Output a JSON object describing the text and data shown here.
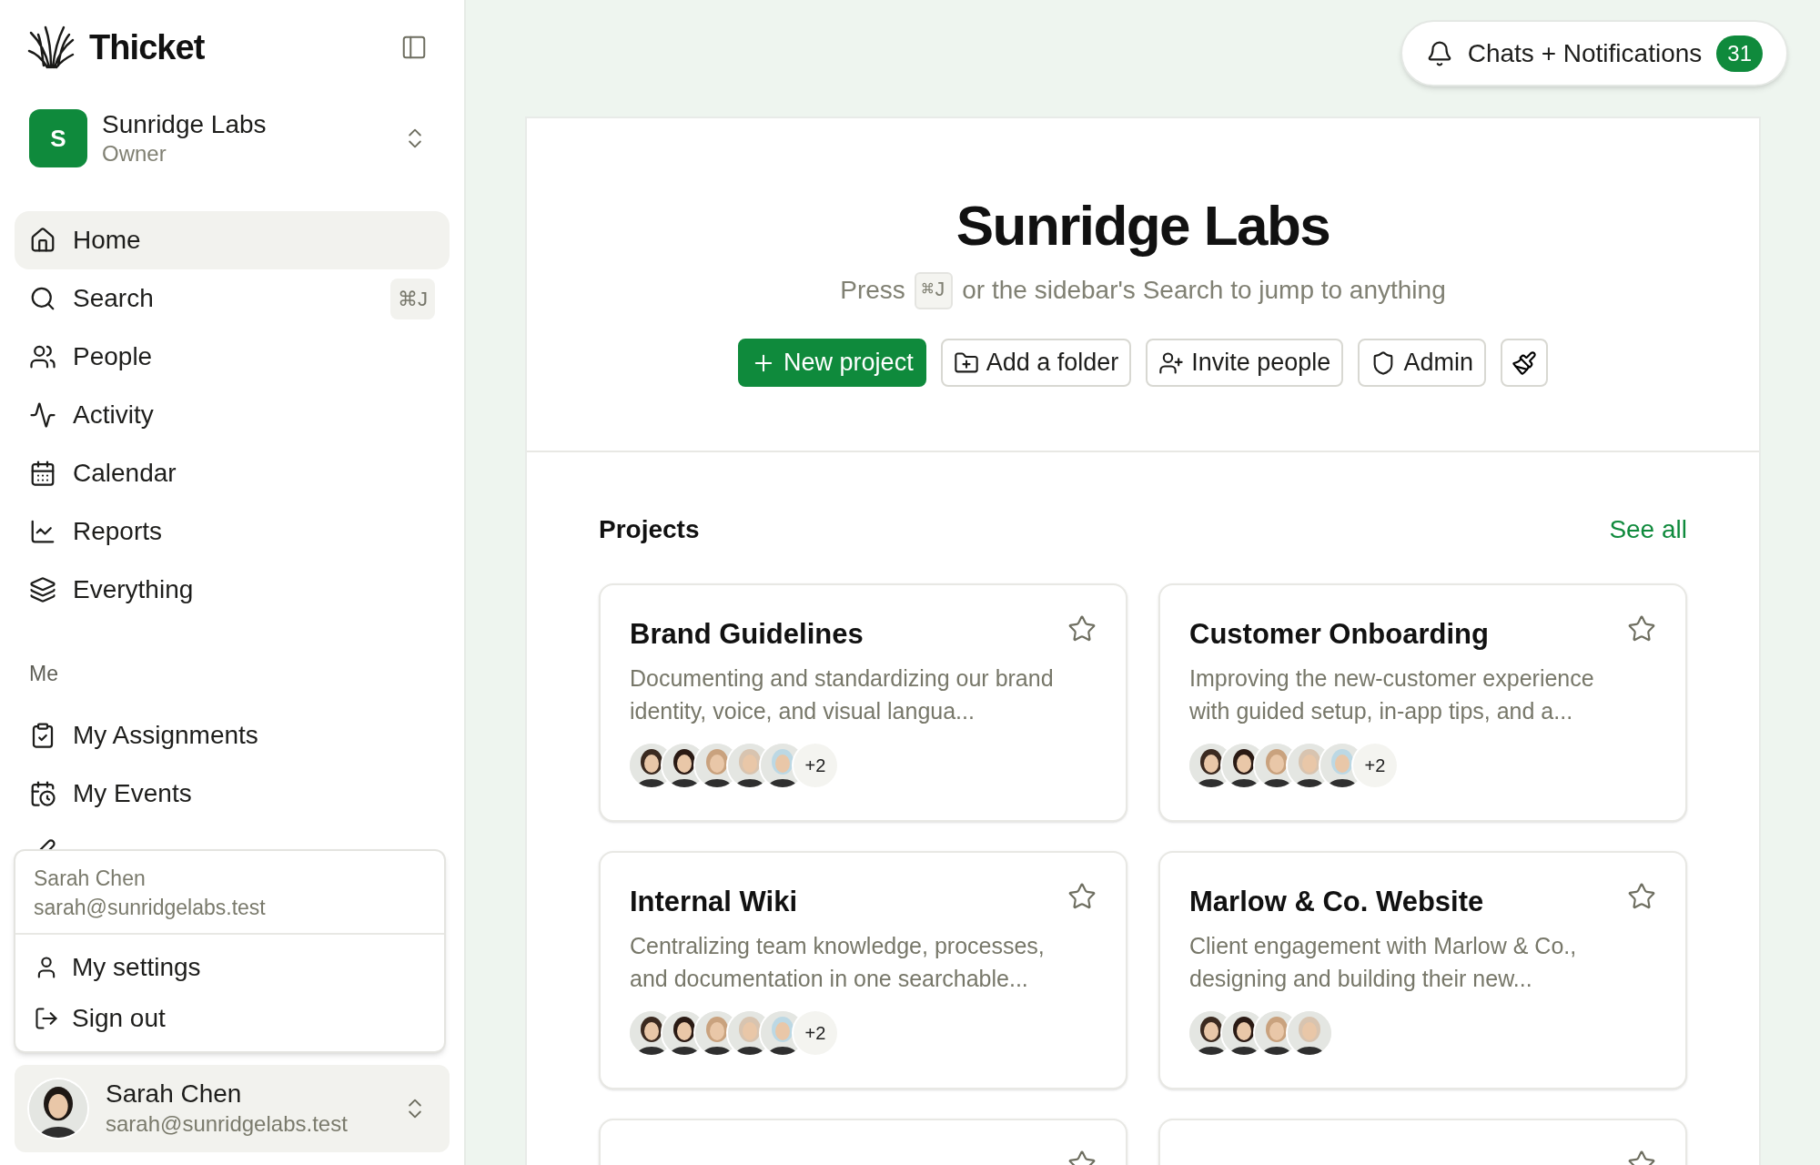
{
  "sidebar": {
    "brand": "Thicket",
    "workspace": {
      "initial": "S",
      "name": "Sunridge Labs",
      "role": "Owner"
    },
    "nav": [
      {
        "label": "Home",
        "selected": true
      },
      {
        "label": "Search",
        "selected": false,
        "shortcut": "⌘J"
      },
      {
        "label": "People",
        "selected": false
      },
      {
        "label": "Activity",
        "selected": false
      },
      {
        "label": "Calendar",
        "selected": false
      },
      {
        "label": "Reports",
        "selected": false
      },
      {
        "label": "Everything",
        "selected": false
      }
    ],
    "me_heading": "Me",
    "me_items": [
      {
        "label": "My Assignments",
        "selected": false
      },
      {
        "label": "My Events",
        "selected": false
      },
      {
        "selected": false
      }
    ],
    "user_menu": {
      "name": "Sarah Chen",
      "email": "sarah@sunridgelabs.test",
      "items": [
        "My settings",
        "Sign out"
      ]
    },
    "user": {
      "name": "Sarah Chen",
      "email": "sarah@sunridgelabs.test"
    }
  },
  "notifications": {
    "label": "Chats + Notifications",
    "count": "31"
  },
  "header": {
    "title": "Sunridge Labs",
    "hint_before": "Press",
    "hint_key": "⌘J",
    "hint_after": "or the sidebar's Search to jump to anything",
    "actions": [
      {
        "kind": "primary",
        "label": "New project"
      },
      {
        "kind": "outline",
        "label": "Add a folder"
      },
      {
        "kind": "outline",
        "label": "Invite people"
      },
      {
        "kind": "outline",
        "label": "Admin"
      },
      {
        "kind": "icon"
      }
    ]
  },
  "projects": {
    "heading": "Projects",
    "see_all": "See all",
    "cards": [
      {
        "title": "Brand Guidelines",
        "description": "Documenting and standardizing our brand identity, voice, and visual langua...",
        "starred": false,
        "more": "+2"
      },
      {
        "title": "Customer Onboarding",
        "description": "Improving the new-customer experience with guided setup, in-app tips, and a...",
        "starred": false,
        "more": "+2"
      },
      {
        "title": "Internal Wiki",
        "description": "Centralizing team knowledge, processes, and documentation in one searchable...",
        "starred": false,
        "more": "+2"
      },
      {
        "title": "Marlow & Co. Website",
        "description": "Client engagement with Marlow & Co., designing and building their new...",
        "starred": false
      },
      {
        "starred": false
      },
      {
        "starred": false
      }
    ]
  }
}
